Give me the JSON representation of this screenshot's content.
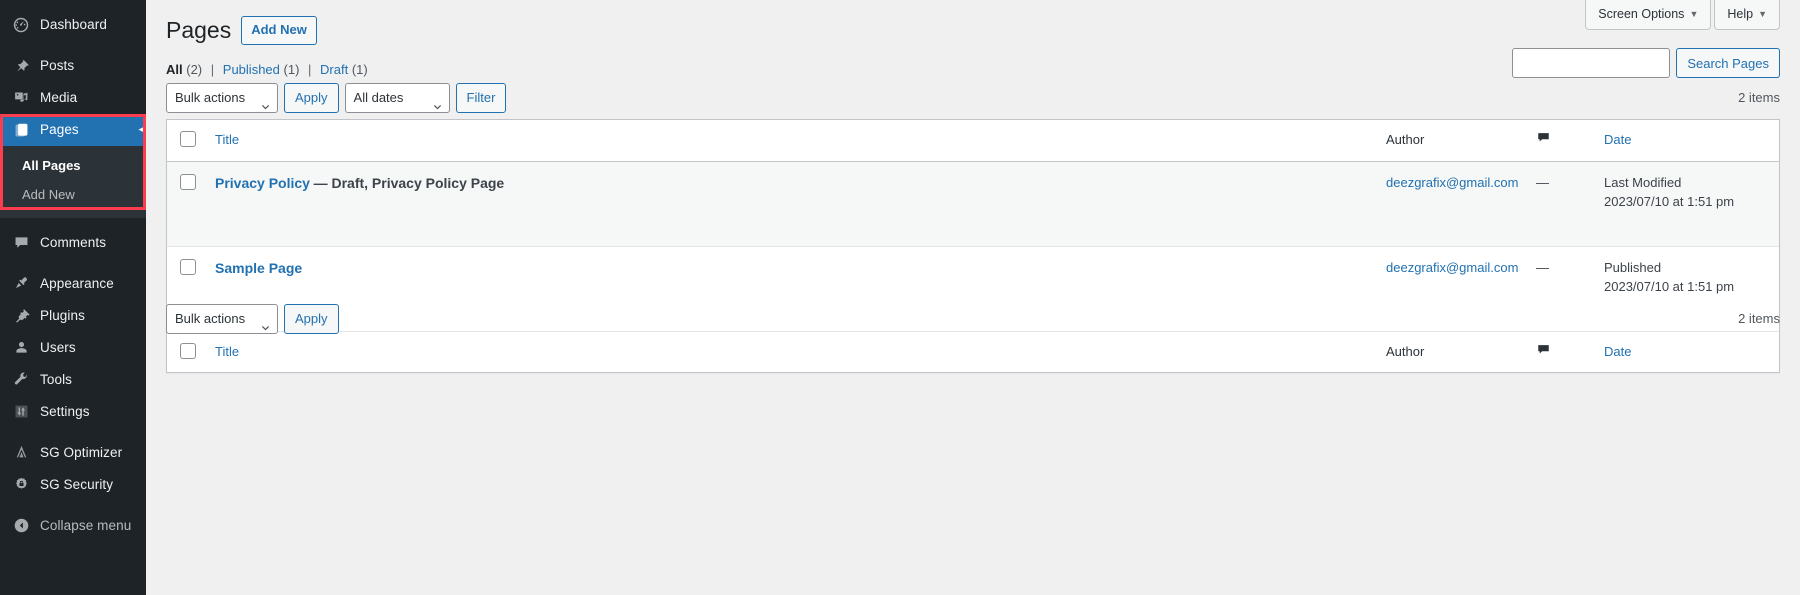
{
  "sidebar": {
    "items": [
      {
        "label": "Dashboard",
        "icon": "dashboard-icon",
        "id": "dashboard"
      },
      {
        "label": "Posts",
        "icon": "pin-icon",
        "id": "posts"
      },
      {
        "label": "Media",
        "icon": "media-icon",
        "id": "media"
      },
      {
        "label": "Pages",
        "icon": "pages-icon",
        "id": "pages",
        "current": true
      },
      {
        "label": "Comments",
        "icon": "comment-icon",
        "id": "comments"
      },
      {
        "label": "Appearance",
        "icon": "brush-icon",
        "id": "appearance"
      },
      {
        "label": "Plugins",
        "icon": "plug-icon",
        "id": "plugins"
      },
      {
        "label": "Users",
        "icon": "user-icon",
        "id": "users"
      },
      {
        "label": "Tools",
        "icon": "wrench-icon",
        "id": "tools"
      },
      {
        "label": "Settings",
        "icon": "sliders-icon",
        "id": "settings"
      },
      {
        "label": "SG Optimizer",
        "icon": "sg-optimizer-icon",
        "id": "sg-optimizer"
      },
      {
        "label": "SG Security",
        "icon": "sg-security-icon",
        "id": "sg-security"
      }
    ],
    "submenu": [
      {
        "label": "All Pages",
        "current": true
      },
      {
        "label": "Add New",
        "current": false
      }
    ],
    "collapse_label": "Collapse menu",
    "highlight_color": "#2271b1",
    "annotation_color": "#fb3d4d"
  },
  "screen_meta": {
    "screen_options_label": "Screen Options",
    "help_label": "Help",
    "caret": "▼"
  },
  "header": {
    "title": "Pages",
    "add_new_label": "Add New"
  },
  "filters": {
    "all_label": "All",
    "all_count": "(2)",
    "published_label": "Published",
    "published_count": "(1)",
    "draft_label": "Draft",
    "draft_count": "(1)",
    "separator": "|"
  },
  "search": {
    "value": "",
    "placeholder": "",
    "submit_label": "Search Pages"
  },
  "tablenav": {
    "top": {
      "bulk_actions_label": "Bulk actions",
      "apply_label": "Apply",
      "dates_label": "All dates",
      "filter_label": "Filter",
      "items_count": "2 items"
    },
    "bottom": {
      "bulk_actions_label": "Bulk actions",
      "apply_label": "Apply",
      "items_count": "2 items"
    }
  },
  "table": {
    "columns": {
      "title": "Title",
      "author": "Author",
      "comments": "comment-icon",
      "date": "Date"
    },
    "rows": [
      {
        "title": "Privacy Policy",
        "state": "— Draft, Privacy Policy Page",
        "author": "deezgrafix@gmail.com",
        "comments": "—",
        "date_status": "Last Modified",
        "date_value": "2023/07/10 at 1:51 pm"
      },
      {
        "title": "Sample Page",
        "state": "",
        "author": "deezgrafix@gmail.com",
        "comments": "—",
        "date_status": "Published",
        "date_value": "2023/07/10 at 1:51 pm"
      }
    ]
  }
}
